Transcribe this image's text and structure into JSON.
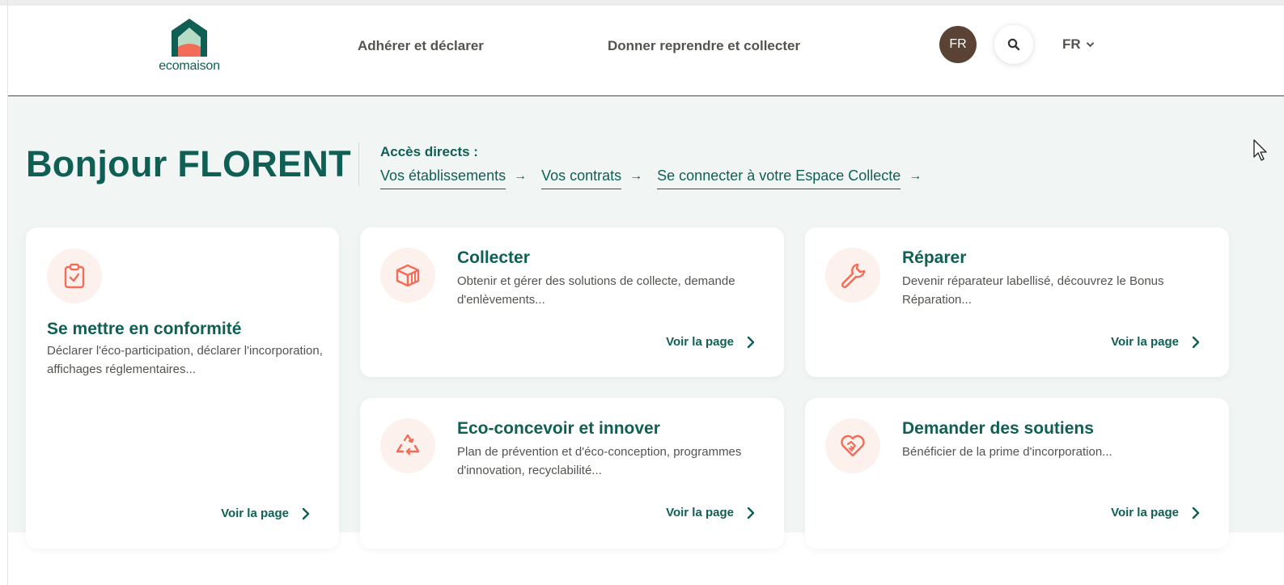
{
  "header": {
    "logo_text": "ecomaison",
    "nav": [
      "Adhérer et déclarer",
      "Donner reprendre et collecter"
    ],
    "avatar_initials": "FR",
    "language": "FR"
  },
  "hero": {
    "greeting": "Bonjour FLORENT",
    "access_title": "Accès directs :",
    "access_links": [
      "Vos établissements",
      "Vos contrats",
      "Se connecter à votre Espace Collecte"
    ],
    "arrow": "→"
  },
  "cards": [
    {
      "title": "Se mettre en conformité",
      "desc": "Déclarer l'éco-participation, déclarer l'incorporation, affichages réglementaires...",
      "link": "Voir la page",
      "icon": "clipboard-check-icon"
    },
    {
      "title": "Collecter",
      "desc": "Obtenir et gérer des solutions de collecte, demande d'enlèvements...",
      "link": "Voir la page",
      "icon": "box-icon"
    },
    {
      "title": "Réparer",
      "desc": "Devenir réparateur labellisé, découvrez le Bonus Réparation...",
      "link": "Voir la page",
      "icon": "wrench-icon"
    },
    {
      "title": "Eco-concevoir et innover",
      "desc": "Plan de prévention et d'éco-conception, programmes d'innovation, recyclabilité...",
      "link": "Voir la page",
      "icon": "recycle-icon"
    },
    {
      "title": "Demander des soutiens",
      "desc": "Bénéficier de la prime d'incorporation...",
      "link": "Voir la page",
      "icon": "heart-handshake-icon"
    }
  ],
  "colors": {
    "brand": "#0f5f55",
    "accent": "#f36c57",
    "icon_bg": "#fdf1ee",
    "hero_bg": "#f1f6f5",
    "avatar_bg": "#5a4235"
  }
}
